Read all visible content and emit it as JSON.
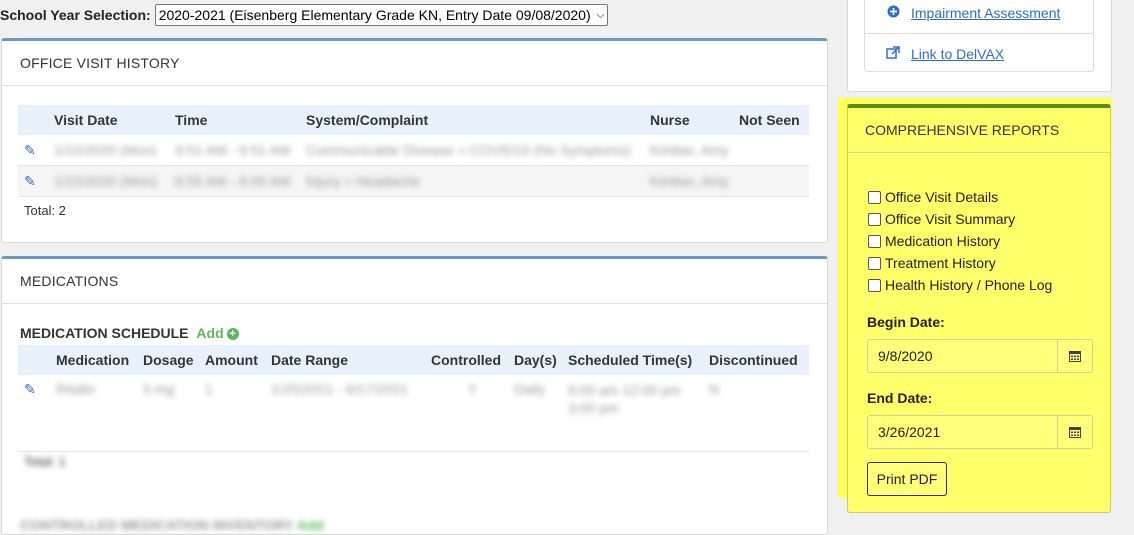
{
  "school_year": {
    "label": "School Year Selection:",
    "selected": "2020-2021 (Eisenberg Elementary Grade KN, Entry Date 09/08/2020)"
  },
  "office_visit": {
    "title": "OFFICE VISIT HISTORY",
    "columns": [
      "Visit Date",
      "Time",
      "System/Complaint",
      "Nurse",
      "Not Seen"
    ],
    "rows": [
      [
        "1/10/2020 (Mon)",
        "9:51 AM - 9:51 AM",
        "Communicable Disease > COVID19 (No Symptoms)",
        "Kimber, Amy"
      ],
      [
        "1/10/2020 (Mon)",
        "8:55 AM - 9:00 AM",
        "Injury > Headache",
        "Kimber, Amy"
      ]
    ],
    "total": "Total: 2"
  },
  "medications": {
    "title": "MEDICATIONS",
    "schedule_label": "MEDICATION SCHEDULE",
    "add_label": "Add",
    "columns": [
      "Medication",
      "Dosage",
      "Amount",
      "Date Range",
      "Controlled",
      "Day(s)",
      "Scheduled Time(s)",
      "Discontinued"
    ],
    "row": [
      "Ritalin",
      "5 mg",
      "1",
      "1/25/2021 - 6/17/2021",
      "Y",
      "Daily",
      "9:00 am 12:00 pm 3:00 pm",
      "N"
    ],
    "total": "Total: 1",
    "next_section": "CONTROLLED MEDICATION INVENTORY",
    "next_add": "Add"
  },
  "links": {
    "impairment": "Impairment Assessment",
    "delvax": "Link to DelVAX"
  },
  "reports": {
    "title": "COMPREHENSIVE REPORTS",
    "options": [
      "Office Visit Details",
      "Office Visit Summary",
      "Medication History",
      "Treatment History",
      "Health History / Phone Log"
    ],
    "begin_label": "Begin Date:",
    "begin_value": "9/8/2020",
    "end_label": "End Date:",
    "end_value": "3/26/2021",
    "print_label": "Print PDF"
  },
  "colors": {
    "highlight": "#ffff54",
    "panel_accent": "#6b9ac4",
    "report_accent": "#5c8a24",
    "link": "#2c6fcb"
  }
}
